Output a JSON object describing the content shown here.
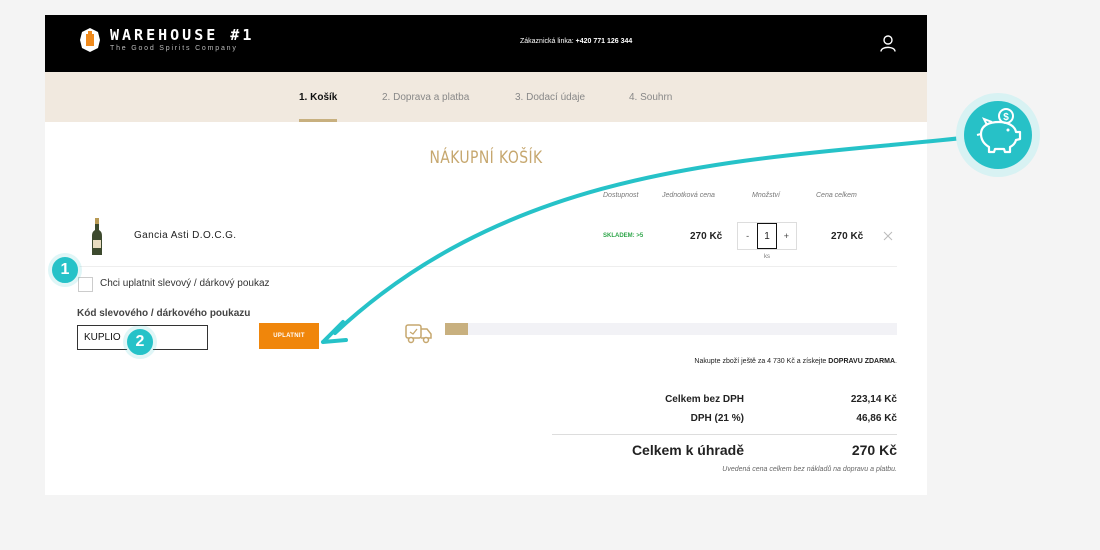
{
  "header": {
    "brand": "WAREHOUSE #1",
    "tagline": "The Good Spirits Company",
    "hotline_label": "Zákaznická linka:",
    "hotline_number": "+420 771 126 344",
    "user_icon": "user-icon"
  },
  "steps": [
    {
      "label": "1.  Košík",
      "active": true
    },
    {
      "label": "2.  Doprava a platba",
      "active": false
    },
    {
      "label": "3.  Dodací údaje",
      "active": false
    },
    {
      "label": "4.  Souhrn",
      "active": false
    }
  ],
  "cart": {
    "title": "NÁKUPNÍ KOŠÍK",
    "columns": {
      "availability": "Dostupnost",
      "unit_price": "Jednotková cena",
      "quantity": "Množství",
      "total": "Cena celkem"
    },
    "item": {
      "name": "Gancia Asti D.O.C.G.",
      "availability": "SKLADEM: >5",
      "unit_price": "270 Kč",
      "qty_minus": "-",
      "quantity": "1",
      "qty_plus": "+",
      "qty_unit": "ks",
      "total": "270 Kč"
    }
  },
  "voucher": {
    "checkbox_label": "Chci uplatnit slevový / dárkový poukaz",
    "code_label": "Kód slevového / dárkového poukazu",
    "code_value": "KUPLIO",
    "apply_label": "UPLATNIT"
  },
  "shipping": {
    "progress": 0.05,
    "note_prefix": "Nakupte zboží ještě za 4 730 Kč a získejte ",
    "note_bold": "DOPRAVU ZDARMA",
    "note_suffix": "."
  },
  "summary": {
    "without_vat_label": "Celkem bez DPH",
    "without_vat_value": "223,14 Kč",
    "vat_label": "DPH (21 %)",
    "vat_value": "46,86 Kč",
    "total_label": "Celkem k úhradě",
    "total_value": "270 Kč",
    "footnote": "Uvedená cena celkem bez nákladů na dopravu a platbu."
  },
  "annotations": {
    "marker_1": "1",
    "marker_2": "2",
    "piggy_icon": "piggy-bank-icon",
    "accent_color": "#26c2c8",
    "brand_gold": "#c6a76e",
    "button_orange": "#f0860b"
  }
}
